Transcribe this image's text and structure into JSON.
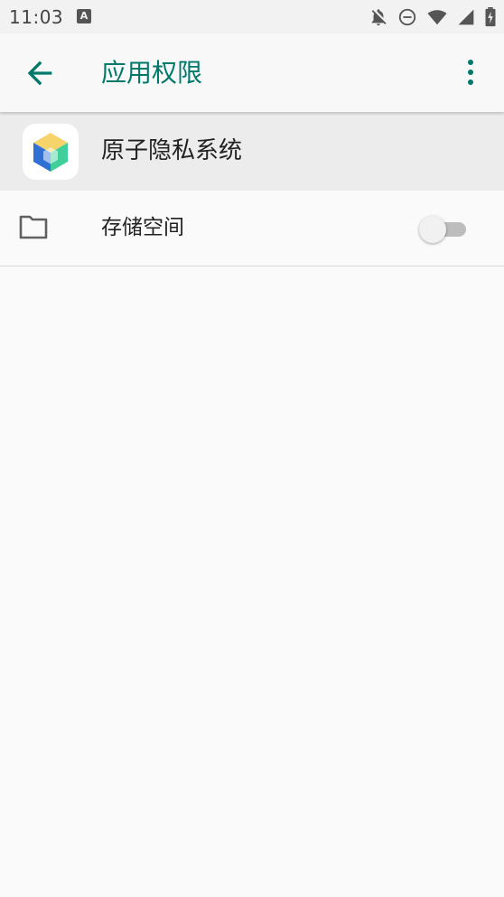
{
  "status_bar": {
    "time": "11:03",
    "notification_icon_letter": "A",
    "icons": [
      "notifications-off-icon",
      "do-not-disturb-icon",
      "wifi-icon",
      "cell-signal-icon",
      "battery-charging-icon"
    ]
  },
  "app_bar": {
    "title": "应用权限",
    "back_icon": "arrow-back-icon",
    "more_icon": "more-vert-icon"
  },
  "app": {
    "name": "原子隐私系统",
    "icon": "cube-app-icon"
  },
  "permissions": [
    {
      "label": "存储空间",
      "icon": "folder-icon",
      "enabled": false
    }
  ],
  "colors": {
    "accent": "#00796b",
    "status_bar_bg": "#f2f2f2",
    "header_bg": "#ececec",
    "page_bg": "#fafafa",
    "toggle_off_track": "#bdbdbd",
    "toggle_off_thumb": "#f1f1f1"
  }
}
